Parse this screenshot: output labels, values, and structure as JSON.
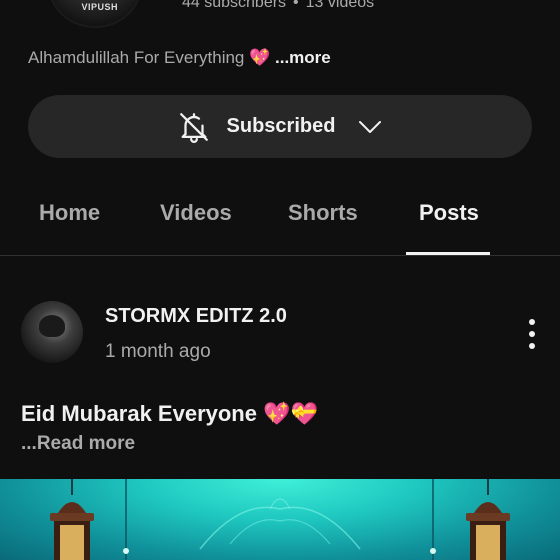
{
  "channel": {
    "subscribers": "44 subscribers",
    "separator": "•",
    "videos": "13 videos",
    "description": "Alhamdulillah For Everything 💖",
    "description_more": "...more",
    "avatar_mark": "VIPUSH"
  },
  "subscribe": {
    "label": "Subscribed",
    "bell_icon": "bell-off-icon",
    "chevron_icon": "chevron-down-icon"
  },
  "tabs": [
    {
      "label": "Home",
      "active": false
    },
    {
      "label": "Videos",
      "active": false
    },
    {
      "label": "Shorts",
      "active": false
    },
    {
      "label": "Posts",
      "active": true
    }
  ],
  "post": {
    "author": "STORMX EDITZ 2.0",
    "time": "1 month ago",
    "text": "Eid Mubarak Everyone 💖💝",
    "read_more": "...Read more",
    "menu_icon": "more-vert-icon"
  },
  "colors": {
    "background": "#0f0f0f",
    "button_bg": "#272727",
    "text_primary": "#f1f1f1",
    "text_secondary": "#aaaaaa",
    "image_teal": "#1fc8c0"
  }
}
